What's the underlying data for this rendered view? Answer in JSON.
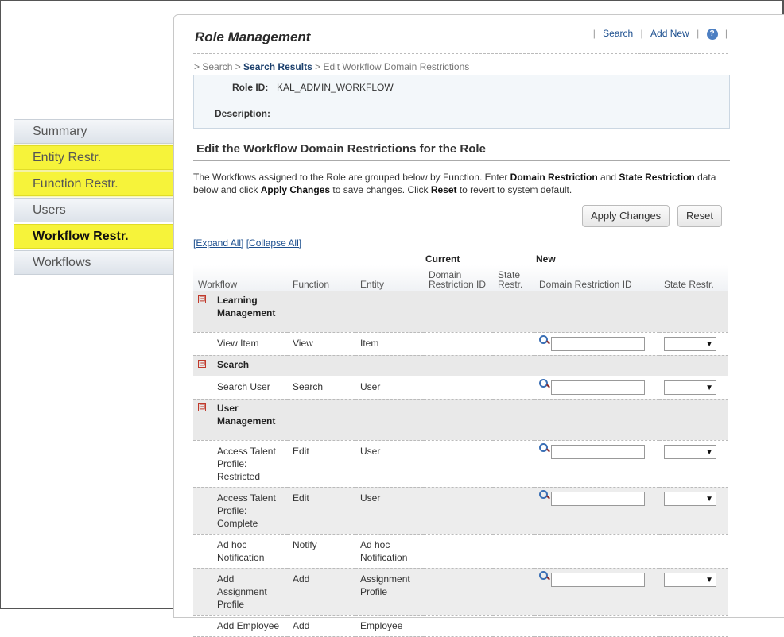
{
  "sidebar": {
    "items": [
      {
        "label": "Summary"
      },
      {
        "label": "Entity Restr."
      },
      {
        "label": "Function Restr."
      },
      {
        "label": "Users"
      },
      {
        "label": "Workflow Restr."
      },
      {
        "label": "Workflows"
      }
    ]
  },
  "header": {
    "title": "Role Management",
    "links": {
      "search": "Search",
      "add_new": "Add New",
      "help": "?",
      "sep": "|"
    }
  },
  "breadcrumb": {
    "prefix": "> Search > ",
    "results": "Search Results",
    "suffix": " > Edit Workflow Domain Restrictions"
  },
  "role": {
    "id_label": "Role ID:",
    "id_value": "KAL_ADMIN_WORKFLOW",
    "desc_label": "Description:",
    "desc_value": ""
  },
  "section": {
    "title": "Edit the Workflow Domain Restrictions for the Role",
    "intro": {
      "p1": "The Workflows assigned to the Role are grouped below by Function. Enter ",
      "b1": "Domain Restriction",
      "p2": " and ",
      "b2": "State Restriction",
      "p3": " data below and click ",
      "b3": "Apply Changes",
      "p4": " to save changes. Click ",
      "b4": "Reset",
      "p5": " to revert to system default."
    }
  },
  "buttons": {
    "apply": "Apply Changes",
    "reset": "Reset"
  },
  "expand": {
    "expand_all": "[Expand All]",
    "collapse_all": "[Collapse All]"
  },
  "table": {
    "group_headers": {
      "current": "Current",
      "new": "New"
    },
    "columns": {
      "workflow": "Workflow",
      "function": "Function",
      "entity": "Entity",
      "cur_domain": "Domain Restriction ID",
      "cur_state": "State Restr.",
      "new_domain": "Domain Restriction ID",
      "new_state": "State Restr."
    },
    "collapse_symbol": "⊟",
    "groups": [
      {
        "name": "Learning Management",
        "rows": [
          {
            "workflow": "View Item",
            "function": "View",
            "entity": "Item",
            "editable": true
          }
        ]
      },
      {
        "name": "Search",
        "rows": [
          {
            "workflow": "Search User",
            "function": "Search",
            "entity": "User",
            "editable": true
          }
        ]
      },
      {
        "name": "User Management",
        "rows": [
          {
            "workflow": "Access Talent Profile: Restricted",
            "function": "Edit",
            "entity": "User",
            "editable": true
          },
          {
            "workflow": "Access Talent Profile: Complete",
            "function": "Edit",
            "entity": "User",
            "editable": true
          },
          {
            "workflow": "Ad hoc Notification",
            "function": "Notify",
            "entity": "Ad hoc Notification",
            "editable": false
          },
          {
            "workflow": "Add Assignment Profile",
            "function": "Add",
            "entity": "Assignment Profile",
            "editable": true
          },
          {
            "workflow": "Add Employee",
            "function": "Add",
            "entity": "Employee",
            "editable": false
          }
        ]
      }
    ]
  },
  "icons": {
    "lookup": "magnifier-icon",
    "dropdown": "dropdown-arrow-icon",
    "collapse": "collapse-minus-icon",
    "help": "help-icon"
  },
  "colors": {
    "highlight": "#f6f33a",
    "link": "#1c4f8f",
    "group_bg": "#e9e9e9"
  }
}
